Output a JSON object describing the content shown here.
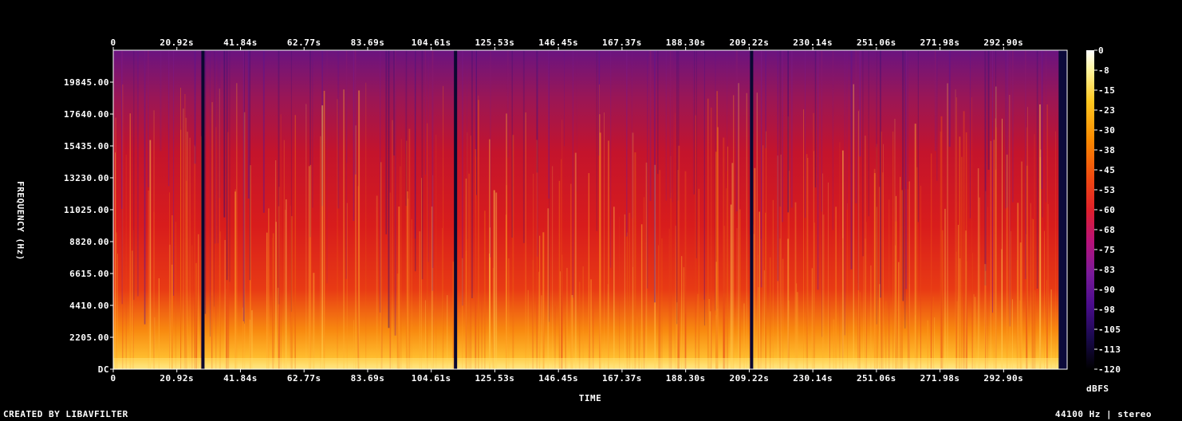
{
  "chart_data": {
    "type": "heatmap",
    "title": "",
    "xlabel": "TIME",
    "ylabel": "FREQUENCY (Hz)",
    "x_ticks": [
      "0",
      "20.92s",
      "41.84s",
      "62.77s",
      "83.69s",
      "104.61s",
      "125.53s",
      "146.45s",
      "167.37s",
      "188.30s",
      "209.22s",
      "230.14s",
      "251.06s",
      "271.98s",
      "292.90s"
    ],
    "x_tick_values": [
      0,
      20.92,
      41.84,
      62.77,
      83.69,
      104.61,
      125.53,
      146.45,
      167.37,
      188.3,
      209.22,
      230.14,
      251.06,
      271.98,
      292.9
    ],
    "xlim": [
      0,
      313.8
    ],
    "y_ticks": [
      "DC",
      "2205.00",
      "4410.00",
      "6615.00",
      "8820.00",
      "11025.00",
      "13230.00",
      "15435.00",
      "17640.00",
      "19845.00"
    ],
    "y_tick_values": [
      0,
      2205,
      4410,
      6615,
      8820,
      11025,
      13230,
      15435,
      17640,
      19845
    ],
    "ylim": [
      0,
      22050
    ],
    "colorbar": {
      "label": "dBFS",
      "ticks": [
        "0",
        "-8",
        "-15",
        "-23",
        "-30",
        "-38",
        "-45",
        "-53",
        "-60",
        "-68",
        "-75",
        "-83",
        "-90",
        "-98",
        "-105",
        "-113",
        "-120"
      ],
      "range": [
        -120,
        0
      ],
      "colors": [
        "#000000",
        "#1a0a4e",
        "#4a0c8c",
        "#7a1a9a",
        "#b8127a",
        "#e0202a",
        "#f04a10",
        "#fa8a00",
        "#ffc820",
        "#fff5a0",
        "#ffffff"
      ]
    },
    "silent_gaps_s": [
      29.5,
      112.6,
      210.0
    ],
    "quiet_tail_s": [
      311.0,
      313.8
    ]
  },
  "footer": {
    "left": "CREATED BY LIBAVFILTER",
    "right": "44100 Hz | stereo"
  }
}
